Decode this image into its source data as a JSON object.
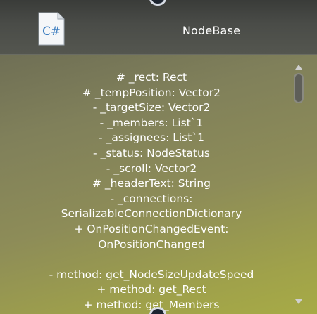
{
  "node": {
    "title": "NodeBase",
    "icon": "csharp-file-icon",
    "icon_label": "C#"
  },
  "members": [
    "# _rect: Rect",
    "# _tempPosition: Vector2",
    "- _targetSize: Vector2",
    "- _members: List`1",
    "- _assignees: List`1",
    "- _status: NodeStatus",
    "- _scroll: Vector2",
    "# _headerText: String",
    "- _connections:",
    "SerializableConnectionDictionary",
    "+ OnPositionChangedEvent:",
    "OnPositionChanged",
    "",
    "- method: get_NodeSizeUpdateSpeed",
    "+ method: get_Rect",
    "+ method: get_Members"
  ],
  "scroll": {
    "position_fraction": 0.0
  },
  "colors": {
    "header": "#4a4c48",
    "body": "#8d8c58",
    "text": "#ffffff",
    "port": "#1c2430"
  }
}
